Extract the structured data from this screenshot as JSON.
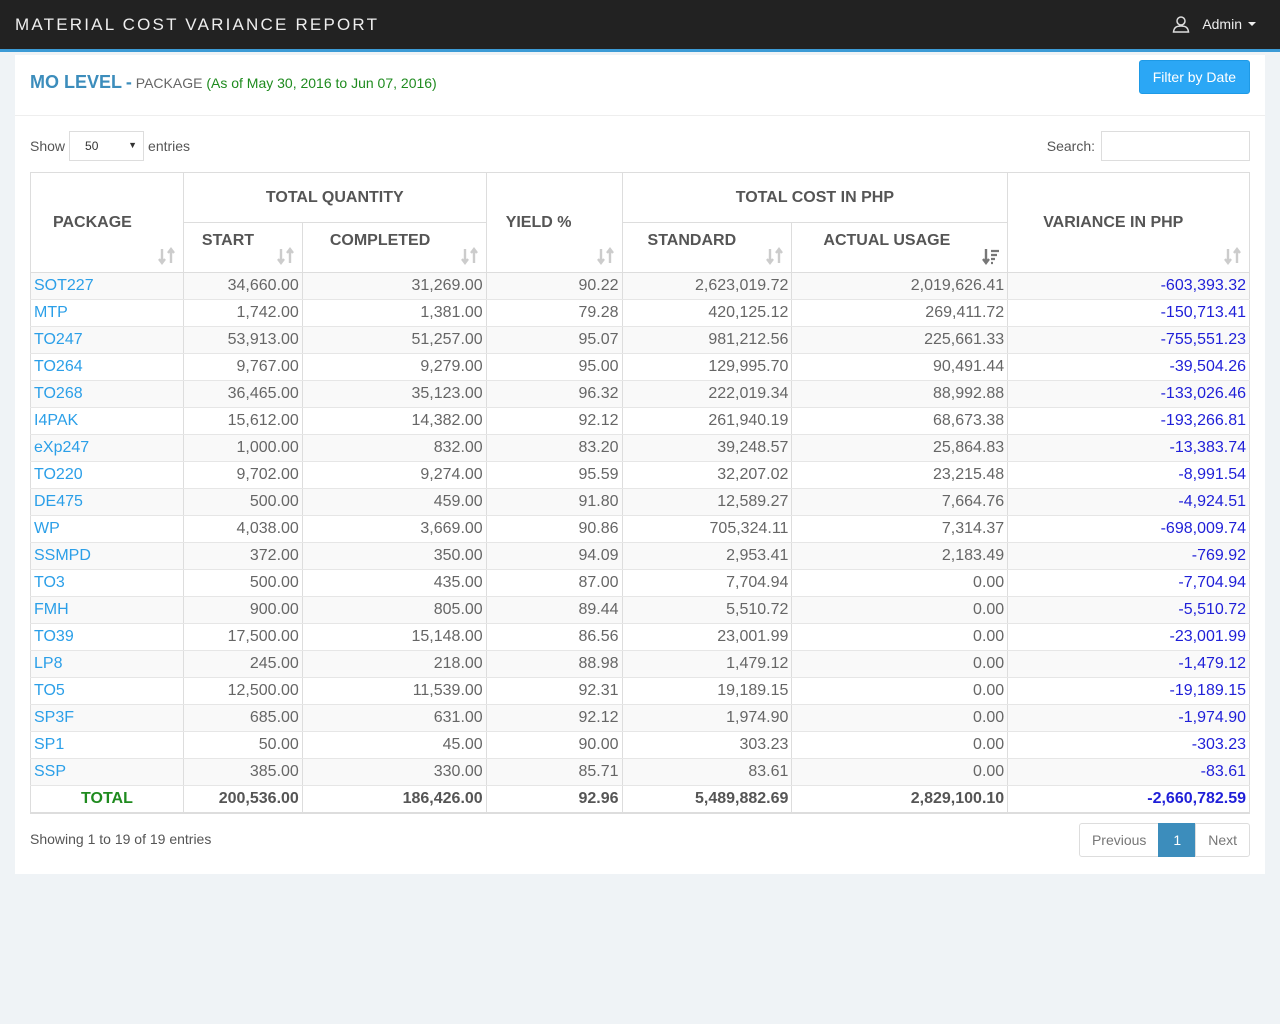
{
  "app": {
    "title": "MATERIAL COST VARIANCE REPORT",
    "user": "Admin"
  },
  "header": {
    "level": "MO LEVEL",
    "separator": "-",
    "subtitle": "PACKAGE",
    "range": "(As of May 30, 2016 to Jun 07, 2016)",
    "filter_button": "Filter by Date"
  },
  "controls": {
    "show_label": "Show",
    "entries_value": "50",
    "entries_label": "entries",
    "search_label": "Search:",
    "search_value": ""
  },
  "table": {
    "headers": {
      "package": "PACKAGE",
      "total_quantity": "TOTAL QUANTITY",
      "start": "START",
      "completed": "COMPLETED",
      "yield": "YIELD %",
      "total_cost": "TOTAL COST IN PHP",
      "standard": "STANDARD",
      "actual": "ACTUAL USAGE",
      "variance": "VARIANCE IN PHP"
    },
    "rows": [
      [
        "SOT227",
        "34,660.00",
        "31,269.00",
        "90.22",
        "2,623,019.72",
        "2,019,626.41",
        "-603,393.32"
      ],
      [
        "MTP",
        "1,742.00",
        "1,381.00",
        "79.28",
        "420,125.12",
        "269,411.72",
        "-150,713.41"
      ],
      [
        "TO247",
        "53,913.00",
        "51,257.00",
        "95.07",
        "981,212.56",
        "225,661.33",
        "-755,551.23"
      ],
      [
        "TO264",
        "9,767.00",
        "9,279.00",
        "95.00",
        "129,995.70",
        "90,491.44",
        "-39,504.26"
      ],
      [
        "TO268",
        "36,465.00",
        "35,123.00",
        "96.32",
        "222,019.34",
        "88,992.88",
        "-133,026.46"
      ],
      [
        "I4PAK",
        "15,612.00",
        "14,382.00",
        "92.12",
        "261,940.19",
        "68,673.38",
        "-193,266.81"
      ],
      [
        "eXp247",
        "1,000.00",
        "832.00",
        "83.20",
        "39,248.57",
        "25,864.83",
        "-13,383.74"
      ],
      [
        "TO220",
        "9,702.00",
        "9,274.00",
        "95.59",
        "32,207.02",
        "23,215.48",
        "-8,991.54"
      ],
      [
        "DE475",
        "500.00",
        "459.00",
        "91.80",
        "12,589.27",
        "7,664.76",
        "-4,924.51"
      ],
      [
        "WP",
        "4,038.00",
        "3,669.00",
        "90.86",
        "705,324.11",
        "7,314.37",
        "-698,009.74"
      ],
      [
        "SSMPD",
        "372.00",
        "350.00",
        "94.09",
        "2,953.41",
        "2,183.49",
        "-769.92"
      ],
      [
        "TO3",
        "500.00",
        "435.00",
        "87.00",
        "7,704.94",
        "0.00",
        "-7,704.94"
      ],
      [
        "FMH",
        "900.00",
        "805.00",
        "89.44",
        "5,510.72",
        "0.00",
        "-5,510.72"
      ],
      [
        "TO39",
        "17,500.00",
        "15,148.00",
        "86.56",
        "23,001.99",
        "0.00",
        "-23,001.99"
      ],
      [
        "LP8",
        "245.00",
        "218.00",
        "88.98",
        "1,479.12",
        "0.00",
        "-1,479.12"
      ],
      [
        "TO5",
        "12,500.00",
        "11,539.00",
        "92.31",
        "19,189.15",
        "0.00",
        "-19,189.15"
      ],
      [
        "SP3F",
        "685.00",
        "631.00",
        "92.12",
        "1,974.90",
        "0.00",
        "-1,974.90"
      ],
      [
        "SP1",
        "50.00",
        "45.00",
        "90.00",
        "303.23",
        "0.00",
        "-303.23"
      ],
      [
        "SSP",
        "385.00",
        "330.00",
        "85.71",
        "83.61",
        "0.00",
        "-83.61"
      ]
    ],
    "total": [
      "TOTAL",
      "200,536.00",
      "186,426.00",
      "92.96",
      "5,489,882.69",
      "2,829,100.10",
      "-2,660,782.59"
    ]
  },
  "footer": {
    "info": "Showing 1 to 19 of 19 entries",
    "prev": "Previous",
    "page": "1",
    "next": "Next"
  },
  "colors": {
    "accent": "#3c9bd6",
    "link": "#2b9fe8",
    "variance": "#1f1fd8",
    "total": "#1f8b1f",
    "button": "#2ba7f5"
  }
}
